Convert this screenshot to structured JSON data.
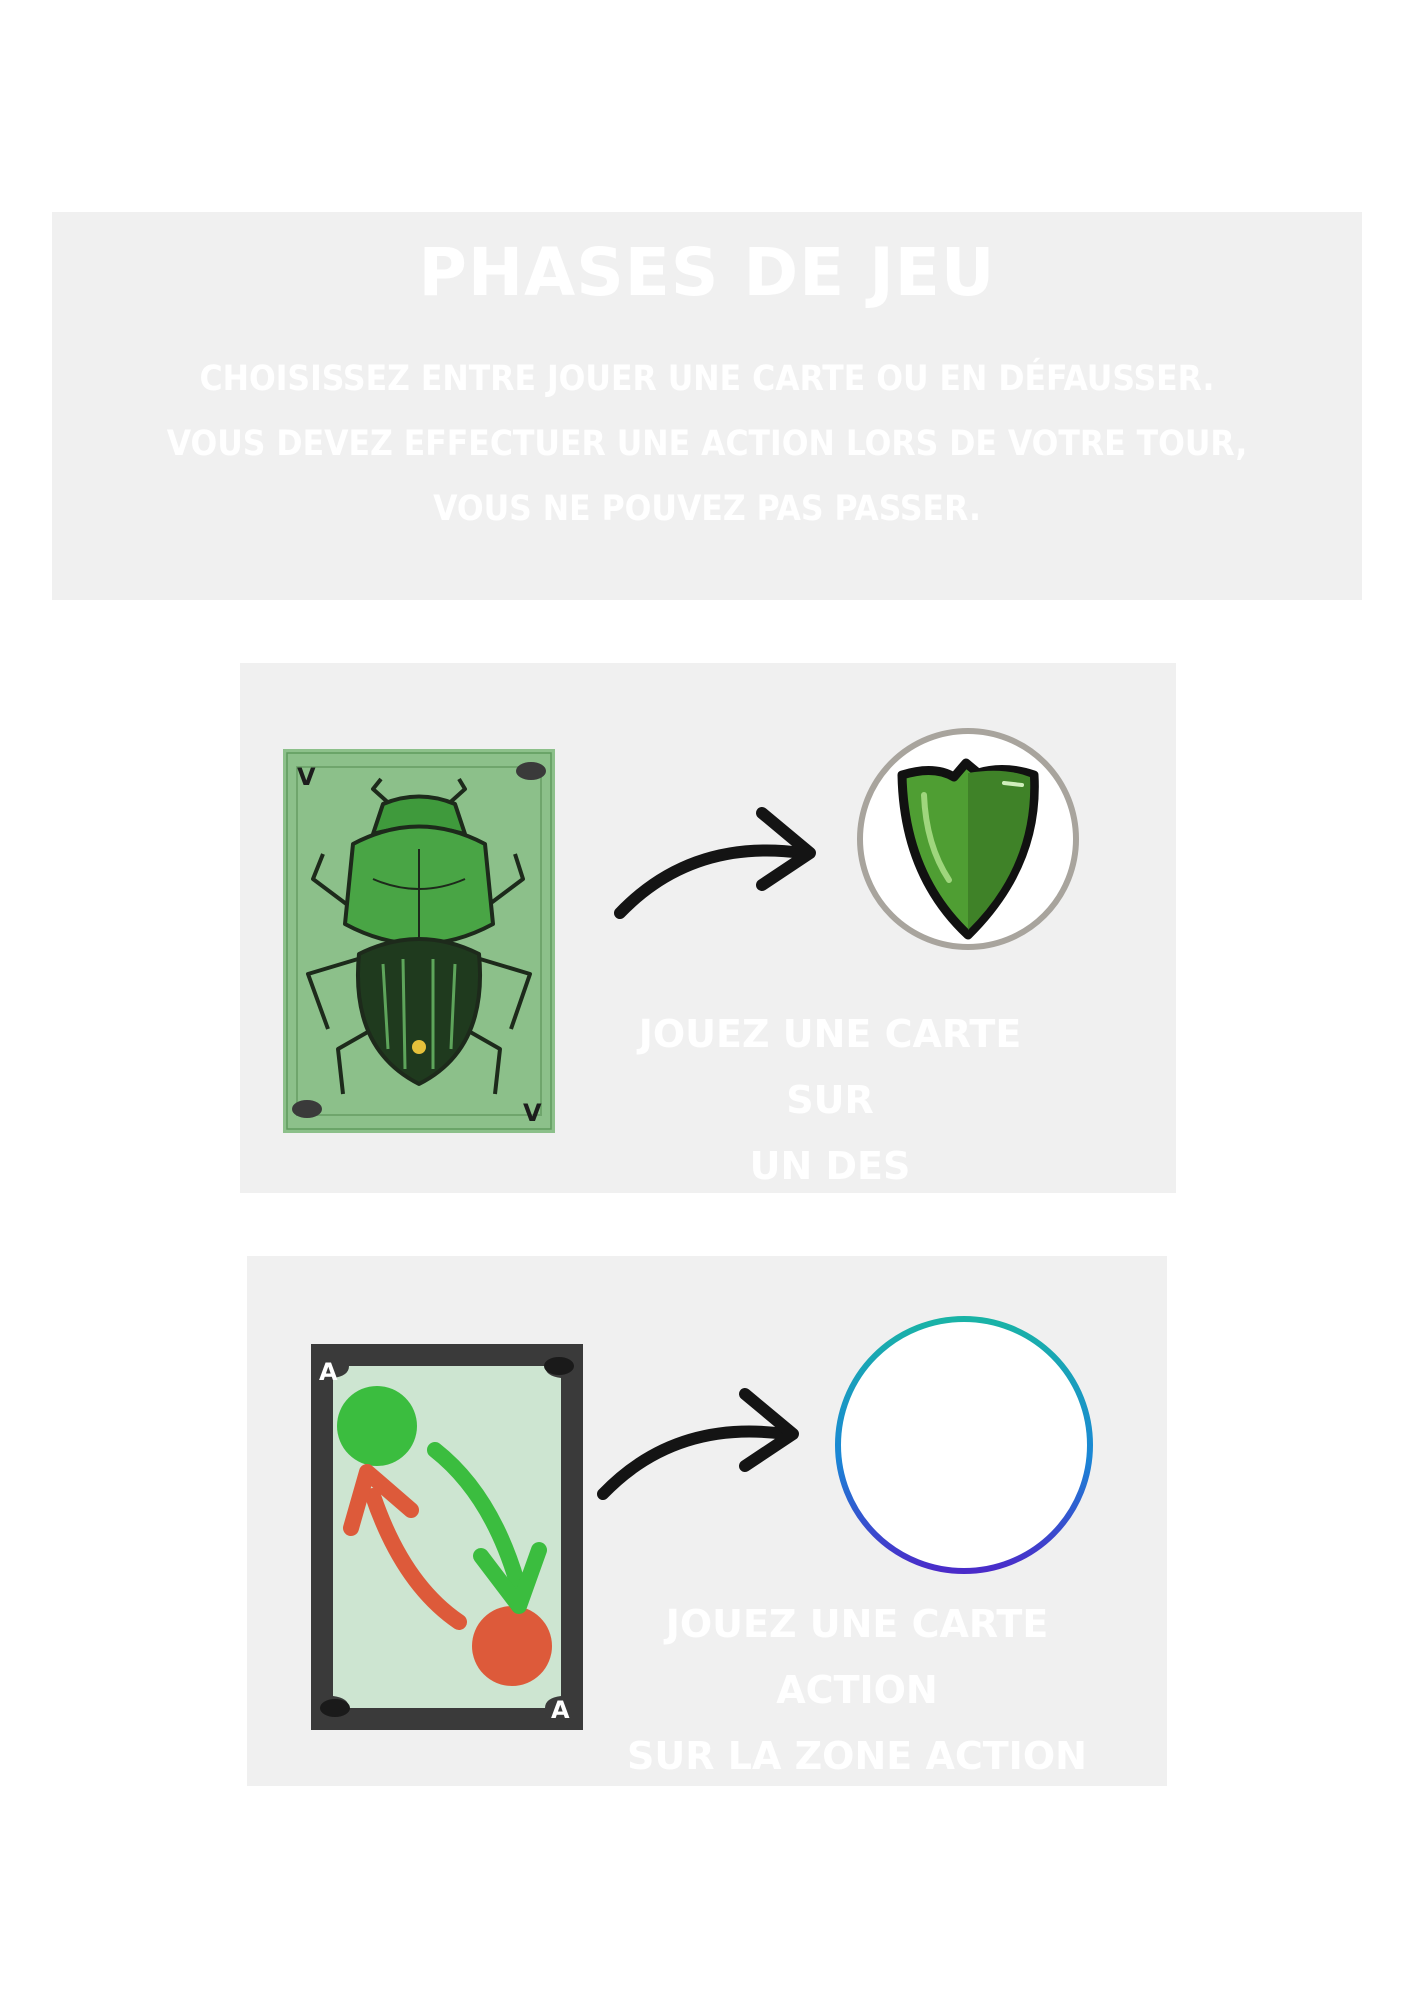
{
  "header": {
    "title": "PHASES DE JEU",
    "lines": [
      "CHOISISSEZ ENTRE JOUER UNE CARTE OU EN DÉFAUSSER.",
      "VOUS DEVEZ EFFECTUER UNE ACTION LORS DE VOTRE TOUR,",
      "VOUS NE POUVEZ PAS PASSER."
    ]
  },
  "step1": {
    "card_rank": "V",
    "caption": [
      "JOUEZ UNE CARTE SUR",
      "UN DES GÉNÉRATEURS"
    ],
    "icons": [
      "beetle-icon",
      "arrow-right-icon",
      "green-shield-icon"
    ]
  },
  "step2": {
    "card_rank": "A",
    "caption": [
      "JOUEZ UNE CARTE ACTION",
      "SUR LA ZONE ACTION"
    ],
    "icons": [
      "swap-arrows-icon",
      "arrow-right-icon",
      "action-zone-ring-icon"
    ]
  },
  "colors": {
    "panel": "#f0f0f0",
    "text": "#ffffff",
    "card_green": "#8cc08a",
    "shield_green": "#4f9e33",
    "action_green": "#3bbd3f",
    "action_red": "#dd5a3a",
    "ring_top": "#19b3a6",
    "ring_bottom": "#4a2bc9"
  }
}
